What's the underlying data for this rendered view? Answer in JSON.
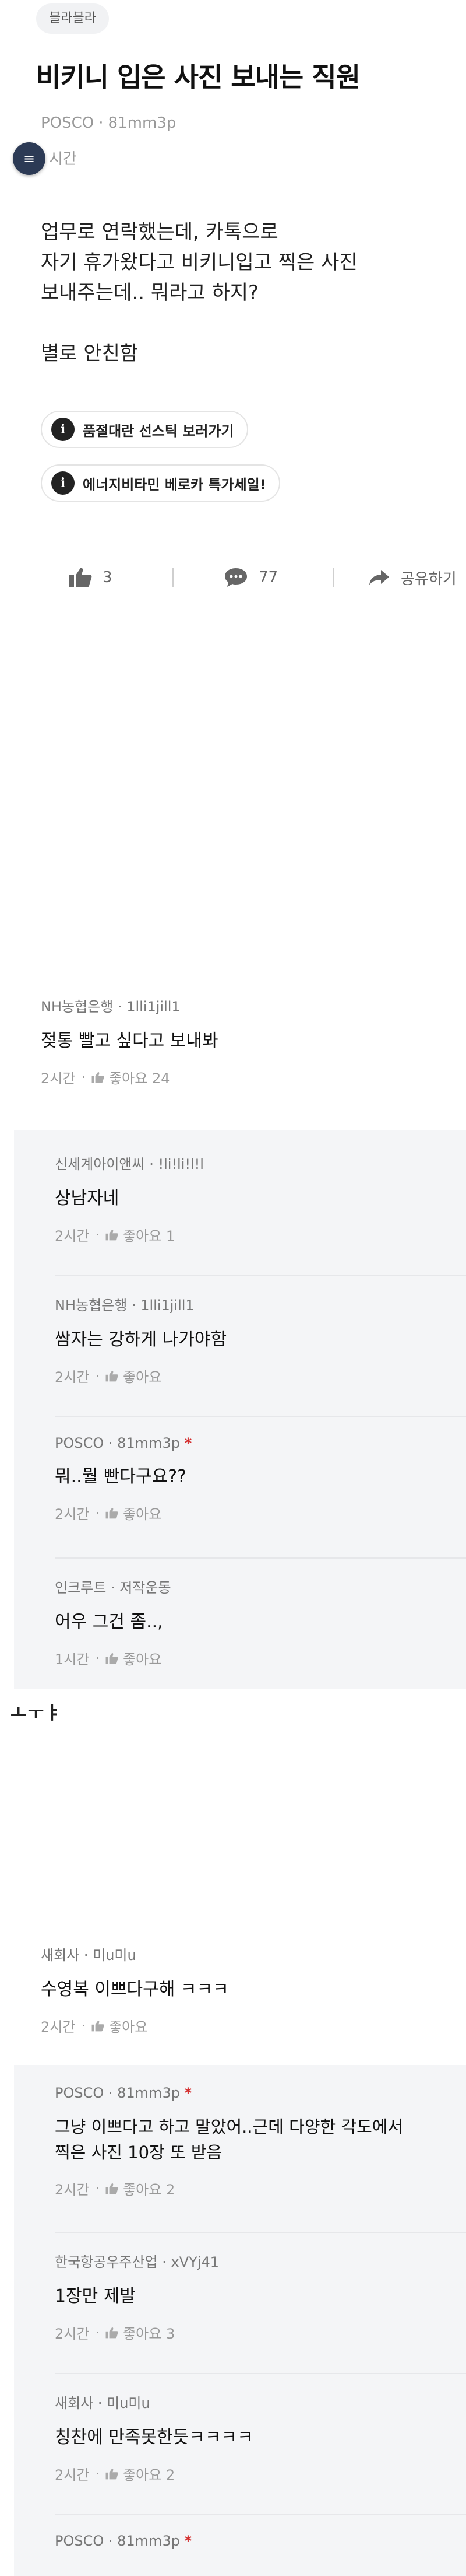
{
  "post": {
    "tag": "블라블라",
    "title": "비키니 입은 사진 보내는 직원",
    "company": "POSCO",
    "author": "81mm3p",
    "time": "시간",
    "body": [
      "업무로 연락했는데, 카톡으로",
      "자기 휴가왔다고 비키니입고 찍은 사진",
      "보내주는데.. 뭐라고 하지?",
      "별로 안친함"
    ],
    "promos": [
      "품절대란 선스틱 보러가기",
      "에너지비타민 베로카 특가세일!"
    ],
    "likes": "3",
    "comments": "77",
    "share": "공유하기"
  },
  "comments_top": [
    {
      "company": "NH농협은행",
      "author": "1lli1jill1",
      "text": "젖통 빨고 싶다고 보내봐",
      "time": "2시간",
      "like_label": "좋아요 24",
      "replies": [
        {
          "company": "신세계아이앤씨",
          "author": "!li!li!l!l",
          "op": false,
          "text": "상남자네",
          "time": "2시간",
          "like_label": "좋아요 1"
        },
        {
          "company": "NH농협은행",
          "author": "1lli1jill1",
          "op": false,
          "text": "쌈자는 강하게 나가야함",
          "time": "2시간",
          "like_label": "좋아요"
        },
        {
          "company": "POSCO",
          "author": "81mm3p",
          "op": true,
          "text": "뭐..뭘 빤다구요??",
          "time": "2시간",
          "like_label": "좋아요"
        },
        {
          "company": "인크루트",
          "author": "저작운동",
          "op": false,
          "text": "어우 그건 좀..,",
          "time": "1시간",
          "like_label": "좋아요"
        }
      ]
    }
  ],
  "cut_text": "ㅗㅜㅑ",
  "comments_bottom": [
    {
      "company": "새회사",
      "author": "미u미u",
      "text": "수영복 이쁘다구해 ㅋㅋㅋ",
      "time": "2시간",
      "like_label": "좋아요",
      "replies": [
        {
          "company": "POSCO",
          "author": "81mm3p",
          "op": true,
          "text": "그냥 이쁘다고 하고 말았어..근데 다양한 각도에서",
          "text2": "찍은 사진 10장 또 받음",
          "time": "2시간",
          "like_label": "좋아요 2"
        },
        {
          "company": "한국항공우주산업",
          "author": "xVYj41",
          "op": false,
          "text": "1장만 제발",
          "time": "2시간",
          "like_label": "좋아요 3"
        },
        {
          "company": "새회사",
          "author": "미u미u",
          "op": false,
          "text": "칭찬에 만족못한듯ㅋㅋㅋㅋ",
          "time": "2시간",
          "like_label": "좋아요 2"
        },
        {
          "company": "POSCO",
          "author": "81mm3p",
          "op": true
        }
      ]
    }
  ],
  "colors": {
    "op_marker": "#d32a2a",
    "reply_bg": "#f4f5f7",
    "fab": "#2c3a55"
  },
  "icons": [
    "menu-icon",
    "info-icon",
    "thumb-up-icon",
    "comment-icon",
    "share-arrow-icon"
  ]
}
